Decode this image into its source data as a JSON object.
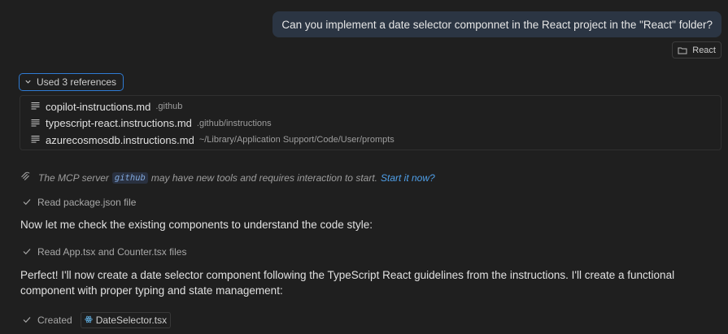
{
  "user_message": {
    "text": "Can you implement a date selector componnet in the React project in the \"React\" folder?",
    "context_chip": {
      "icon": "folder-icon",
      "label": "React"
    }
  },
  "references": {
    "toggle_label": "Used 3 references",
    "expanded": true,
    "items": [
      {
        "icon": "file-lines-icon",
        "name": "copilot-instructions.md",
        "path": ".github"
      },
      {
        "icon": "file-lines-icon",
        "name": "typescript-react.instructions.md",
        "path": ".github/instructions"
      },
      {
        "icon": "file-lines-icon",
        "name": "azurecosmosdb.instructions.md",
        "path": "~/Library/Application Support/Code/User/prompts"
      }
    ]
  },
  "mcp_notice": {
    "icon": "mcp-plug-icon",
    "prefix": "The MCP server",
    "server": "github",
    "suffix": "may have new tools and requires interaction to start.",
    "link": "Start it now?"
  },
  "steps": [
    {
      "icon": "check-icon",
      "label": "Read package.json file"
    },
    {
      "icon": "check-icon",
      "label": "Read App.tsx and Counter.tsx files"
    },
    {
      "icon": "check-icon",
      "label": "Created",
      "file": "DateSelector.tsx",
      "file_icon": "react-icon"
    }
  ],
  "messages": [
    "Now let me check the existing components to understand the code style:",
    "Perfect! I'll now create a date selector component following the TypeScript React guidelines from the instructions. I'll create a functional component with proper typing and state management:"
  ],
  "colors": {
    "background": "#1f1f1f",
    "user_bubble": "#2b3543",
    "accent": "#2f7bd3",
    "link": "#4f9fe8",
    "react_blue": "#5ea8d8"
  }
}
